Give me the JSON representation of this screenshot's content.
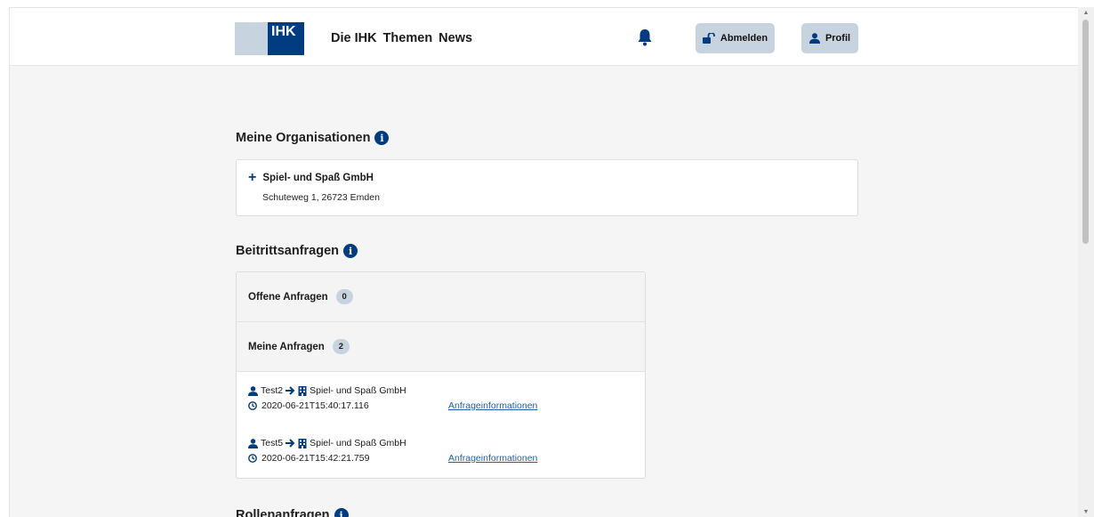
{
  "header": {
    "logo_text": "IHK",
    "nav": [
      "Die IHK",
      "Themen",
      "News"
    ],
    "logout_label": "Abmelden",
    "profile_label": "Profil"
  },
  "organizations": {
    "title": "Meine Organisationen",
    "items": [
      {
        "name": "Spiel- und Spaß GmbH",
        "address": "Schuteweg 1, 26723 Emden"
      }
    ]
  },
  "join_requests": {
    "title": "Beitrittsanfragen",
    "open": {
      "label": "Offene Anfragen",
      "count": "0"
    },
    "mine": {
      "label": "Meine Anfragen",
      "count": "2"
    },
    "items": [
      {
        "user": "Test2",
        "org": "Spiel- und Spaß GmbH",
        "timestamp": "2020-06-21T15:40:17.116",
        "link": "Anfrageinformationen"
      },
      {
        "user": "Test5",
        "org": "Spiel- und Spaß GmbH",
        "timestamp": "2020-06-21T15:42:21.759",
        "link": "Anfrageinformationen"
      }
    ]
  },
  "role_requests": {
    "title": "Rollenanfragen"
  },
  "colors": {
    "brand_blue": "#003c7f",
    "button_bg": "#c8d3e0",
    "link": "#1f5fa6"
  }
}
